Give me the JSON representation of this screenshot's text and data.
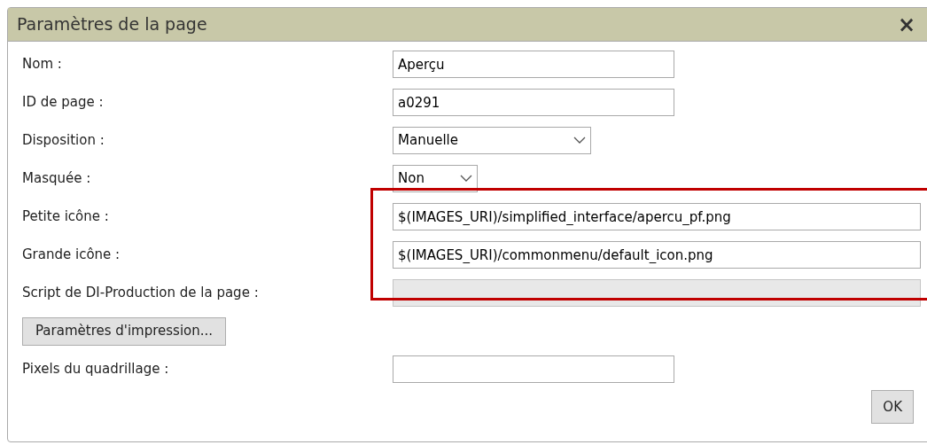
{
  "dialog": {
    "title": "Paramètres de la page",
    "close": "×"
  },
  "fields": [
    {
      "label": "Nom :",
      "kind": "text",
      "value": "Aperçu",
      "disabled": false
    },
    {
      "label": "ID de page :",
      "kind": "text",
      "value": "a0291",
      "disabled": false
    },
    {
      "label": "Disposition :",
      "kind": "select",
      "value": "Manuelle"
    },
    {
      "label": "Masquée :",
      "kind": "short_select",
      "value": "Non"
    },
    {
      "label": "Petite icône :",
      "kind": "long_text",
      "value": "$(IMAGES_URI)/simplified_interface/apercu_pf.png",
      "disabled": false
    },
    {
      "label": "Grande icône :",
      "kind": "long_text",
      "value": "$(IMAGES_URI)/commonmenu/default_icon.png",
      "disabled": false
    },
    {
      "label": "Script de DI-Production de la page :",
      "kind": "long_text",
      "disabled": true
    },
    {
      "label": "Paramètres d'impression...",
      "kind": "button"
    },
    {
      "label": "Pixels du quadrillage :",
      "kind": "text",
      "disabled": false
    }
  ],
  "ok_button": "OK"
}
